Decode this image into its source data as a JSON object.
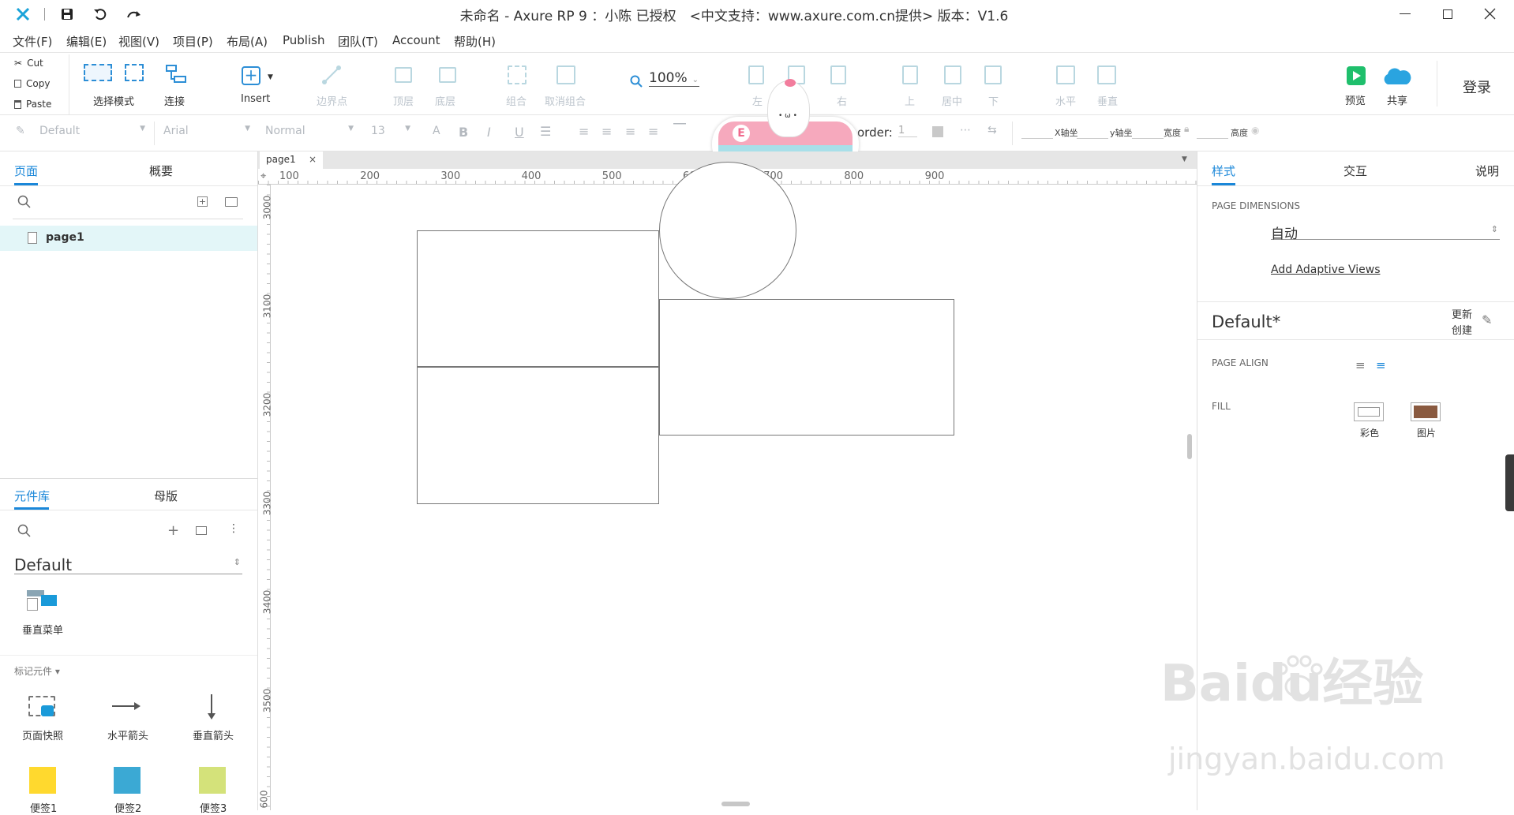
{
  "window": {
    "title": "未命名 - Axure RP 9 ：小陈 已授权　<中文支持：www.axure.com.cn提供> 版本：V1.6",
    "logo_icon": "axure-x-icon"
  },
  "menus": [
    "文件(F)",
    "编辑(E)",
    "视图(V)",
    "项目(P)",
    "布局(A)",
    "Publish",
    "团队(T)",
    "Account",
    "帮助(H)"
  ],
  "clipboard": {
    "cut": "Cut",
    "copy": "Copy",
    "paste": "Paste"
  },
  "toolbar": {
    "select_mode": "选择模式",
    "connect": "连接",
    "insert": "Insert",
    "point": "边界点",
    "top": "顶层",
    "bottom": "底层",
    "group": "组合",
    "ungroup": "取消组合",
    "zoom": "100%",
    "left": "左",
    "center": "居中",
    "right": "右",
    "up": "上",
    "middle": "居中",
    "down": "下",
    "horizontal": "水平",
    "vertical": "垂直",
    "preview": "预览",
    "share": "共享",
    "login": "登录"
  },
  "format": {
    "style": "Default",
    "font": "Arial",
    "weight": "Normal",
    "size": "13",
    "border_label": "order:",
    "border_value": "1",
    "x_label": "X轴坐",
    "y_label": "y轴坐",
    "w_label": "宽度",
    "h_label": "高度"
  },
  "left": {
    "tabs": [
      "页面",
      "概要"
    ],
    "pages": [
      "page1"
    ],
    "lib_tabs": [
      "元件库",
      "母版"
    ],
    "library": "Default",
    "widgets_top": [
      {
        "label": "垂直菜单",
        "icon": "vertical-menu-icon"
      }
    ],
    "markup_section": "标记元件 ▾",
    "markup": [
      {
        "label": "页面快照",
        "icon": "snapshot-icon"
      },
      {
        "label": "水平箭头",
        "icon": "horizontal-arrow-icon"
      },
      {
        "label": "垂直箭头",
        "icon": "vertical-arrow-icon"
      }
    ],
    "notes": [
      {
        "label": "便签1",
        "color": "#ffd92e"
      },
      {
        "label": "便签2",
        "color": "#3ba9d4"
      },
      {
        "label": "便签3",
        "color": "#d4e27a"
      }
    ]
  },
  "canvas": {
    "tab": "page1",
    "ruler_h": [
      "100",
      "200",
      "300",
      "400",
      "500",
      "600",
      "700",
      "800",
      "900"
    ],
    "ruler_v": [
      "3000",
      "3100",
      "3200",
      "3300",
      "3400",
      "3500",
      "600"
    ]
  },
  "right": {
    "tabs": [
      "样式",
      "交互",
      "说明"
    ],
    "page_dimensions": "PAGE DIMENSIONS",
    "dimension_value": "自动",
    "adaptive": "Add Adaptive Views",
    "style_name": "Default*",
    "update": "更新",
    "create": "创建",
    "page_align": "PAGE ALIGN",
    "fill": "FILL",
    "fill_color": "彩色",
    "fill_image": "图片"
  },
  "watermark": {
    "brand": "Baidu经验",
    "url": "jingyan.baidu.com"
  }
}
